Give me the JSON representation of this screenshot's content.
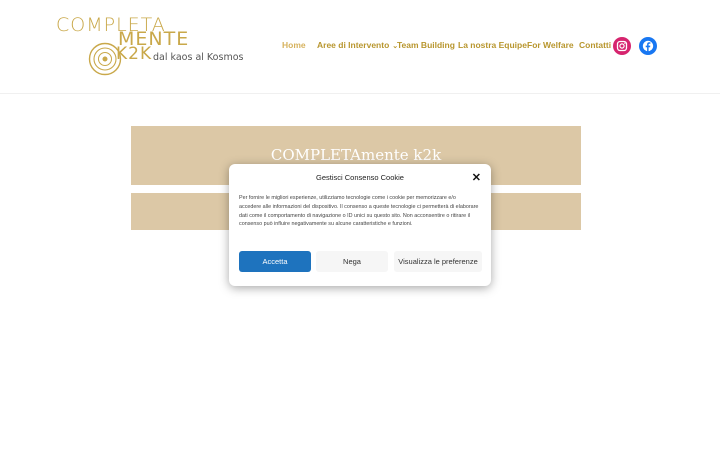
{
  "logo": {
    "line1": "COMPLETA",
    "line2": "MENTE",
    "line3": "K2K",
    "tagline": "dal kaos al Kosmos"
  },
  "nav": {
    "items": [
      {
        "label": "Home"
      },
      {
        "label": "Aree di Intervento"
      },
      {
        "label": "Team Building"
      },
      {
        "label": "La nostra Equipe"
      },
      {
        "label": "For Welfare"
      },
      {
        "label": "Contatti"
      }
    ],
    "dropdown_glyph": "⌄"
  },
  "social": {
    "instagram_icon": "instagram-icon",
    "facebook_icon": "facebook-icon",
    "instagram_color": "#d6246e",
    "facebook_color": "#1877f2"
  },
  "hero": {
    "title": "COMPLETAmente k2k"
  },
  "cookie_modal": {
    "title": "Gestisci Consenso Cookie",
    "close": "✕",
    "body": "Per fornire le migliori esperienze, utilizziamo tecnologie come i cookie per memorizzare e/o accedere alle informazioni del dispositivo. Il consenso a queste tecnologie ci permetterà di elaborare dati come il comportamento di navigazione o ID unici su questo sito. Non acconsentire o ritirare il consenso può influire negativamente su alcune caratteristiche e funzioni.",
    "accept_label": "Accetta",
    "deny_label": "Nega",
    "preferences_label": "Visualizza le preferenze"
  },
  "colors": {
    "brand_gold": "#c9a84a",
    "hero_bg": "#dcc8a6",
    "accept_blue": "#1e73be"
  }
}
